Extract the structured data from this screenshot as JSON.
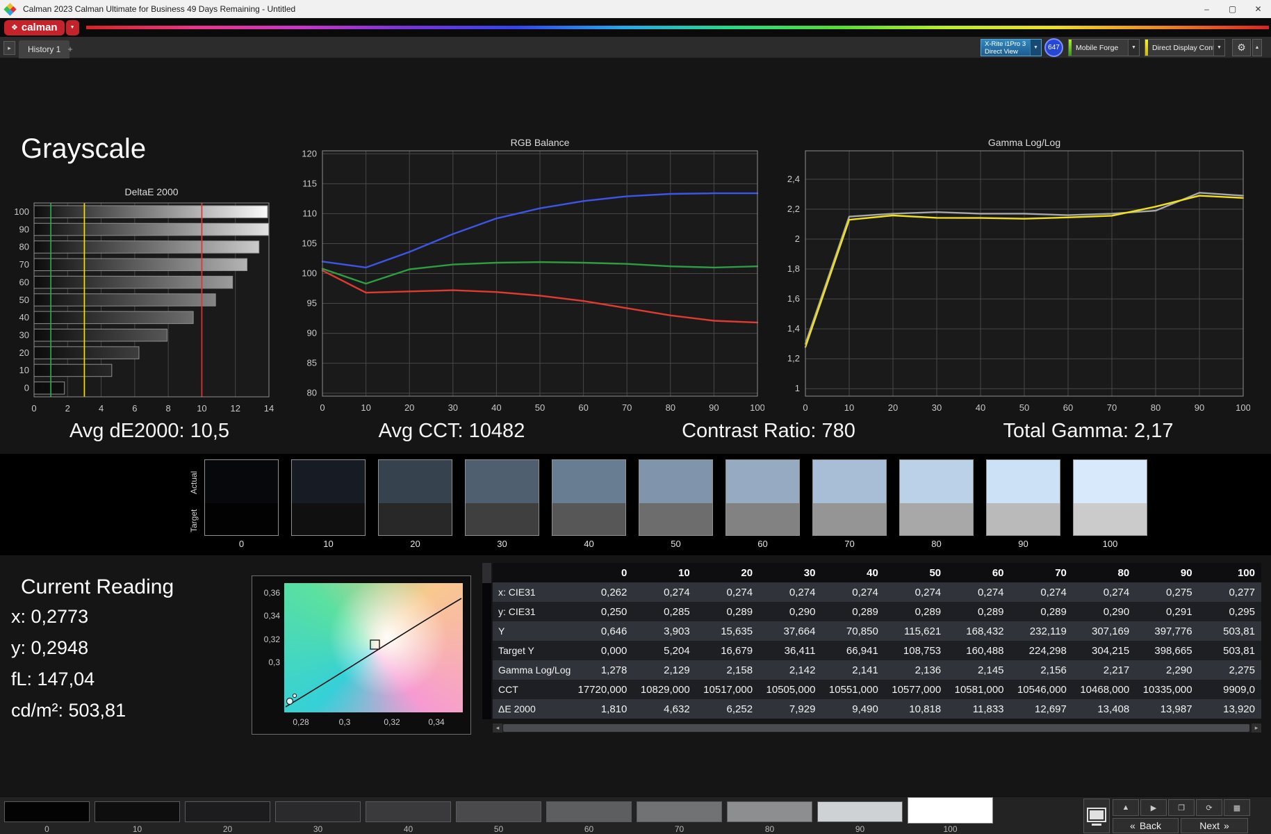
{
  "window": {
    "title": "Calman 2023 Calman Ultimate for Business 49 Days Remaining - Untitled"
  },
  "brand": {
    "name": "calman"
  },
  "icons": {
    "diamond": "❖",
    "menu_caret": "▼",
    "panel_arrow": "▸",
    "chevron_down": "▼",
    "chevron_up": "▲",
    "gear": "⚙",
    "minimize": "–",
    "maximize": "▢",
    "close": "✕",
    "up": "▲",
    "play": "▶",
    "pattern": "❐",
    "refresh": "⟳",
    "grid": "▦",
    "back_chevrons": "«",
    "next_chevrons": "»",
    "scroll_left": "◂",
    "scroll_right": "▸"
  },
  "tabs": {
    "history": "History 1",
    "add": "+"
  },
  "toolbar": {
    "meter_line1": "X-Rite i1Pro 3",
    "meter_line2": "Direct View",
    "badge": "647",
    "source": "Mobile Forge",
    "display_control": "Direct Display Control"
  },
  "page": {
    "title": "Grayscale"
  },
  "stats": [
    "Avg dE2000: 10,5",
    "Avg CCT: 10482",
    "Contrast Ratio: 780",
    "Total Gamma: 2,17"
  ],
  "chart_data": [
    {
      "id": "deltae2000",
      "type": "bar",
      "orientation": "horizontal",
      "title": "DeltaE 2000",
      "categories": [
        100,
        90,
        80,
        70,
        60,
        50,
        40,
        30,
        20,
        10,
        0
      ],
      "values": [
        13.92,
        13.987,
        13.408,
        12.697,
        11.833,
        10.818,
        9.49,
        7.929,
        6.252,
        4.632,
        1.81
      ],
      "xlim": [
        0,
        14
      ],
      "xticks": [
        0,
        2,
        4,
        6,
        8,
        10,
        12,
        14
      ],
      "reference_lines": [
        {
          "x": 1,
          "color": "#2fa84f"
        },
        {
          "x": 3,
          "color": "#f5e000"
        },
        {
          "x": 10,
          "color": "#e03434"
        }
      ]
    },
    {
      "id": "rgb_balance",
      "type": "line",
      "title": "RGB Balance",
      "x": [
        0,
        10,
        20,
        30,
        40,
        50,
        60,
        70,
        80,
        90,
        100
      ],
      "xlim": [
        0,
        100
      ],
      "xticks": [
        0,
        10,
        20,
        30,
        40,
        50,
        60,
        70,
        80,
        90,
        100
      ],
      "ylim": [
        79.5,
        120.5
      ],
      "yticks": [
        {
          "v": 120,
          "label": "120"
        },
        {
          "v": 115,
          "label": "115"
        },
        {
          "v": 110,
          "label": "110"
        },
        {
          "v": 105,
          "label": "105"
        },
        {
          "v": 100,
          "label": "100"
        },
        {
          "v": 95,
          "label": "95"
        },
        {
          "v": 90,
          "label": "90"
        },
        {
          "v": 85,
          "label": "85"
        },
        {
          "v": 80,
          "label": "80"
        }
      ],
      "series": [
        {
          "name": "Blue",
          "color": "#3d55e8",
          "values": [
            102,
            101,
            103.6,
            106.6,
            109.2,
            110.9,
            112.1,
            112.9,
            113.3,
            113.4,
            113.4
          ]
        },
        {
          "name": "Green",
          "color": "#2f9e42",
          "values": [
            100.8,
            98.3,
            100.7,
            101.5,
            101.8,
            101.9,
            101.8,
            101.6,
            101.2,
            101,
            101.2
          ]
        },
        {
          "name": "Red",
          "color": "#e03a32",
          "values": [
            100.5,
            96.8,
            97,
            97.2,
            96.9,
            96.3,
            95.4,
            94.2,
            93,
            92.1,
            91.8
          ]
        }
      ]
    },
    {
      "id": "gamma_loglog",
      "type": "line",
      "title": "Gamma Log/Log",
      "x": [
        0,
        10,
        20,
        30,
        40,
        50,
        60,
        70,
        80,
        90,
        100
      ],
      "xlim": [
        0,
        100
      ],
      "xticks": [
        0,
        10,
        20,
        30,
        40,
        50,
        60,
        70,
        80,
        90,
        100
      ],
      "ylim": [
        0.95,
        2.59
      ],
      "yticks": [
        {
          "v": 2.4,
          "label": "2,4"
        },
        {
          "v": 2.2,
          "label": "2,2"
        },
        {
          "v": 2,
          "label": "2"
        },
        {
          "v": 1.8,
          "label": "1,8"
        },
        {
          "v": 1.6,
          "label": "1,6"
        },
        {
          "v": 1.4,
          "label": "1,4"
        },
        {
          "v": 1.2,
          "label": "1,2"
        },
        {
          "v": 1,
          "label": "1"
        }
      ],
      "series": [
        {
          "name": "Target",
          "color": "#a8a8a8",
          "values": [
            1.3,
            2.15,
            2.17,
            2.18,
            2.17,
            2.17,
            2.16,
            2.17,
            2.19,
            2.31,
            2.29
          ]
        },
        {
          "name": "Measured",
          "color": "#f0e11c",
          "values": [
            1.278,
            2.129,
            2.158,
            2.142,
            2.141,
            2.136,
            2.145,
            2.156,
            2.217,
            2.29,
            2.275
          ]
        }
      ]
    }
  ],
  "swatches": {
    "actual_label": "Actual",
    "target_label": "Target",
    "items": [
      {
        "label": "0",
        "actual": "#07080c",
        "target": "#020202"
      },
      {
        "label": "10",
        "actual": "#171c24",
        "target": "#101010"
      },
      {
        "label": "20",
        "actual": "#36434f",
        "target": "#282828"
      },
      {
        "label": "30",
        "actual": "#4f5f70",
        "target": "#3f3f3f"
      },
      {
        "label": "40",
        "actual": "#687d92",
        "target": "#575757"
      },
      {
        "label": "50",
        "actual": "#8095ab",
        "target": "#6d6d6d"
      },
      {
        "label": "60",
        "actual": "#96abc2",
        "target": "#828282"
      },
      {
        "label": "70",
        "actual": "#a8bed6",
        "target": "#959595"
      },
      {
        "label": "80",
        "actual": "#bbd1e8",
        "target": "#a8a8a8"
      },
      {
        "label": "90",
        "actual": "#cce0f6",
        "target": "#bababa"
      },
      {
        "label": "100",
        "actual": "#d9e9fc",
        "target": "#cbcbcb"
      }
    ]
  },
  "current_reading": {
    "title": "Current Reading",
    "lines": [
      "x: 0,2773",
      "y: 0,2948",
      "fL: 147,04",
      "cd/m²: 503,81"
    ]
  },
  "cie": {
    "x_ticks": [
      "0,28",
      "0,3",
      "0,32",
      "0,34"
    ],
    "y_ticks": [
      "0,36",
      "0,34",
      "0,32",
      "0,3"
    ]
  },
  "table": {
    "columns": [
      "0",
      "10",
      "20",
      "30",
      "40",
      "50",
      "60",
      "70",
      "80",
      "90",
      "100"
    ],
    "rows": [
      {
        "label": "x: CIE31",
        "values": [
          "0,262",
          "0,274",
          "0,274",
          "0,274",
          "0,274",
          "0,274",
          "0,274",
          "0,274",
          "0,274",
          "0,275",
          "0,277"
        ]
      },
      {
        "label": "y: CIE31",
        "values": [
          "0,250",
          "0,285",
          "0,289",
          "0,290",
          "0,289",
          "0,289",
          "0,289",
          "0,289",
          "0,290",
          "0,291",
          "0,295"
        ]
      },
      {
        "label": "Y",
        "values": [
          "0,646",
          "3,903",
          "15,635",
          "37,664",
          "70,850",
          "115,621",
          "168,432",
          "232,119",
          "307,169",
          "397,776",
          "503,81"
        ]
      },
      {
        "label": "Target Y",
        "values": [
          "0,000",
          "5,204",
          "16,679",
          "36,411",
          "66,941",
          "108,753",
          "160,488",
          "224,298",
          "304,215",
          "398,665",
          "503,81"
        ]
      },
      {
        "label": "Gamma Log/Log",
        "values": [
          "1,278",
          "2,129",
          "2,158",
          "2,142",
          "2,141",
          "2,136",
          "2,145",
          "2,156",
          "2,217",
          "2,290",
          "2,275"
        ]
      },
      {
        "label": "CCT",
        "values": [
          "17720,000",
          "10829,000",
          "10517,000",
          "10505,000",
          "10551,000",
          "10577,000",
          "10581,000",
          "10546,000",
          "10468,000",
          "10335,000",
          "9909,0"
        ]
      },
      {
        "label": "ΔE 2000",
        "values": [
          "1,810",
          "4,632",
          "6,252",
          "7,929",
          "9,490",
          "10,818",
          "11,833",
          "12,697",
          "13,408",
          "13,987",
          "13,920"
        ]
      }
    ]
  },
  "patch_bar": {
    "items": [
      {
        "label": "0",
        "color": "#030303"
      },
      {
        "label": "10",
        "color": "#0e0e0e"
      },
      {
        "label": "20",
        "color": "#1c1c1e"
      },
      {
        "label": "30",
        "color": "#2a2a2c"
      },
      {
        "label": "40",
        "color": "#3a3a3c"
      },
      {
        "label": "50",
        "color": "#4a4a4c"
      },
      {
        "label": "60",
        "color": "#5c5e60"
      },
      {
        "label": "70",
        "color": "#707274"
      },
      {
        "label": "80",
        "color": "#8c8e90"
      },
      {
        "label": "90",
        "color": "#ced2d4"
      },
      {
        "label": "100",
        "color": "#ffffff",
        "selected": true
      }
    ]
  },
  "nav": {
    "back": "Back",
    "next": "Next"
  }
}
